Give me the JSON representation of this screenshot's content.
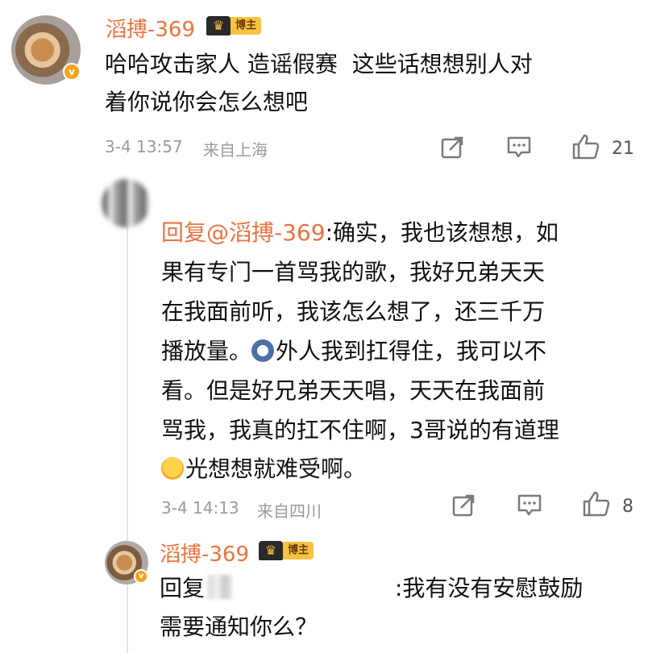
{
  "comment": {
    "username": "滔搏-369",
    "badge_text": "博主",
    "verified_mark": "v",
    "text_line1": "哈哈攻击家人 造谣假赛  这些话想想别人对",
    "text_line2": "着你说你会怎么想吧",
    "time": "3-4 13:57",
    "location": "来自上海",
    "like_count": "21"
  },
  "reply1": {
    "mention": "回复@滔搏-369",
    "line1_rest": ":确实，我也该想想，如",
    "line2": "果有专门一首骂我的歌，我好兄弟天天",
    "line3": "在我面前听，我该怎么想了，还三千万",
    "line4_a": "播放量。",
    "line4_b": "外人我到扛得住，我可以不",
    "line5": "看。但是好兄弟天天唱，天天在我面前",
    "line6": "骂我，我真的扛不住啊，3哥说的有道理",
    "line7": "光想想就难受啊。",
    "time": "3-4 14:13",
    "location": "来自四川",
    "like_count": "8"
  },
  "reply2": {
    "username": "滔搏-369",
    "badge_text": "博主",
    "verified_mark": "v",
    "prefix": "回复",
    "line1_rest": ":我有没有安慰鼓励",
    "line2": "需要通知你么？"
  },
  "icons": {
    "share": "share-icon",
    "comment": "comment-icon",
    "like": "thumb-up-icon"
  },
  "colors": {
    "username": "#eb7340",
    "badge": "#f6c343",
    "meta": "#9a9a9a"
  }
}
